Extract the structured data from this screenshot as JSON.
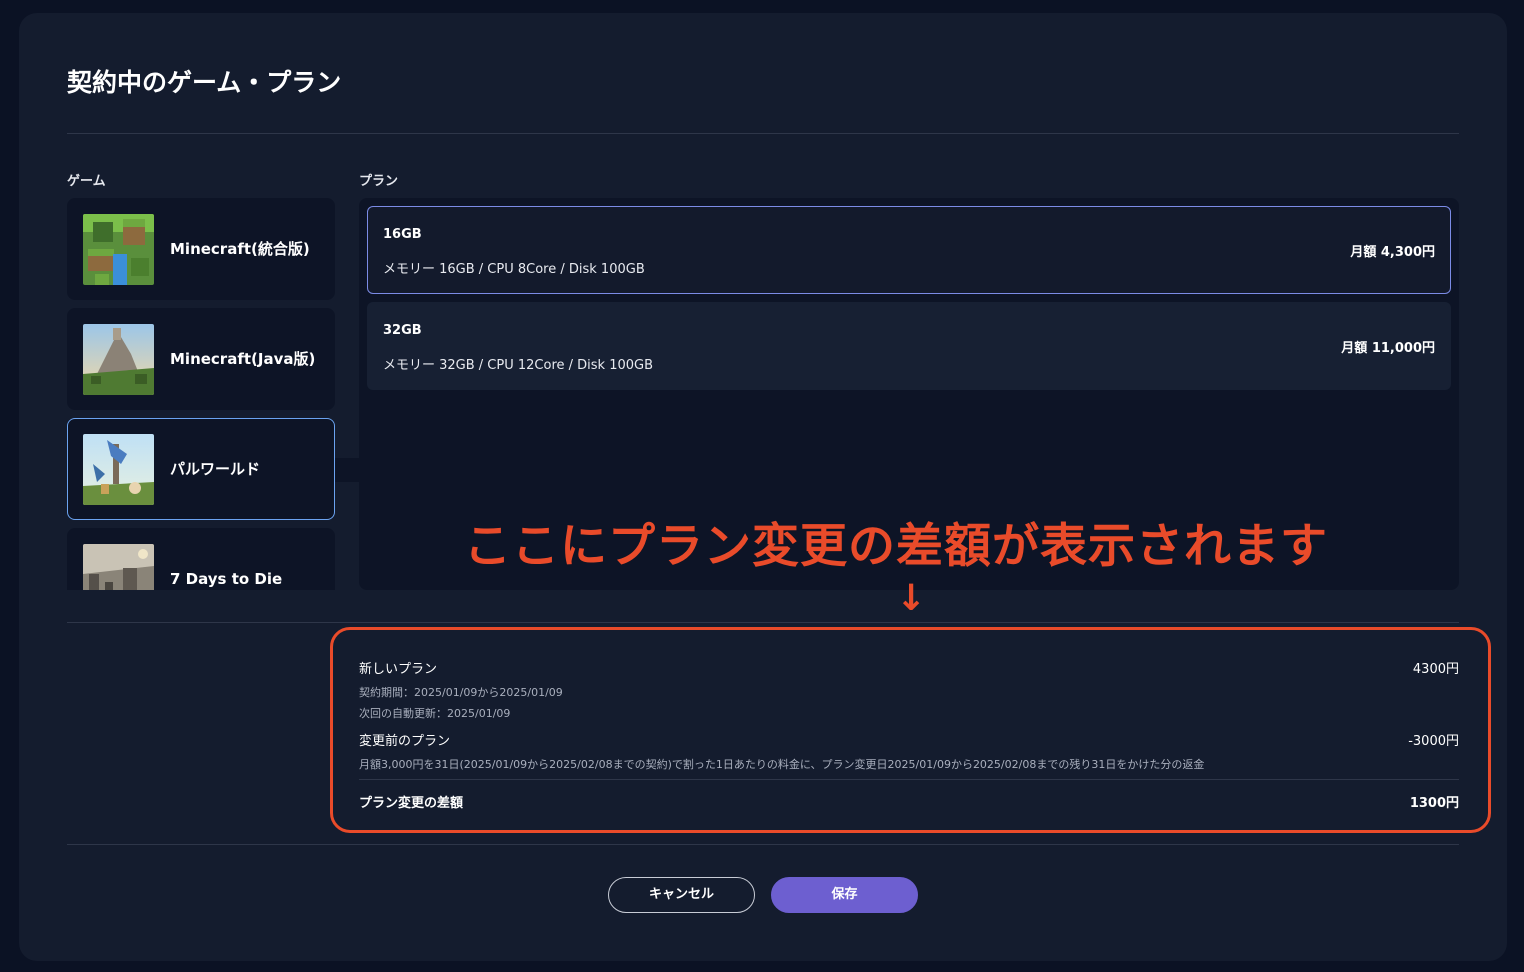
{
  "header": {
    "title": "契約中のゲーム・プラン"
  },
  "games_section": {
    "label": "ゲーム",
    "items": [
      {
        "name": "Minecraft(統合版)",
        "thumb": "minecraft-bedrock-thumbnail"
      },
      {
        "name": "Minecraft(Java版)",
        "thumb": "minecraft-java-thumbnail"
      },
      {
        "name": "パルワールド",
        "thumb": "palworld-thumbnail",
        "selected": true
      },
      {
        "name": "7 Days to Die",
        "thumb": "7-days-to-die-thumbnail"
      }
    ]
  },
  "plans_section": {
    "label": "プラン",
    "items": [
      {
        "name": "16GB",
        "spec": "メモリー 16GB / CPU 8Core / Disk 100GB",
        "price": "月額 4,300円",
        "selected": true
      },
      {
        "name": "32GB",
        "spec": "メモリー 32GB / CPU 12Core / Disk 100GB",
        "price": "月額 11,000円"
      }
    ]
  },
  "annotation": {
    "text": "ここにプラン変更の差額が表示されます",
    "arrow": "↓"
  },
  "summary": {
    "new_plan": {
      "title": "新しいプラン",
      "period": "契約期間：2025/01/09から2025/01/09",
      "renewal": "次回の自動更新：2025/01/09",
      "amount": "4300円"
    },
    "old_plan": {
      "title": "変更前のプラン",
      "detail": "月額3,000円を31日(2025/01/09から2025/02/08までの契約)で割った1日あたりの料金に、プラン変更日2025/01/09から2025/02/08までの残り31日をかけた分の返金",
      "amount": "-3000円"
    },
    "total": {
      "label": "プラン変更の差額",
      "amount": "1300円"
    }
  },
  "buttons": {
    "cancel": "キャンセル",
    "save": "保存"
  },
  "colors": {
    "accent": "#6d5fd0",
    "annotation": "#e94b2a",
    "background": "#141c2e"
  }
}
